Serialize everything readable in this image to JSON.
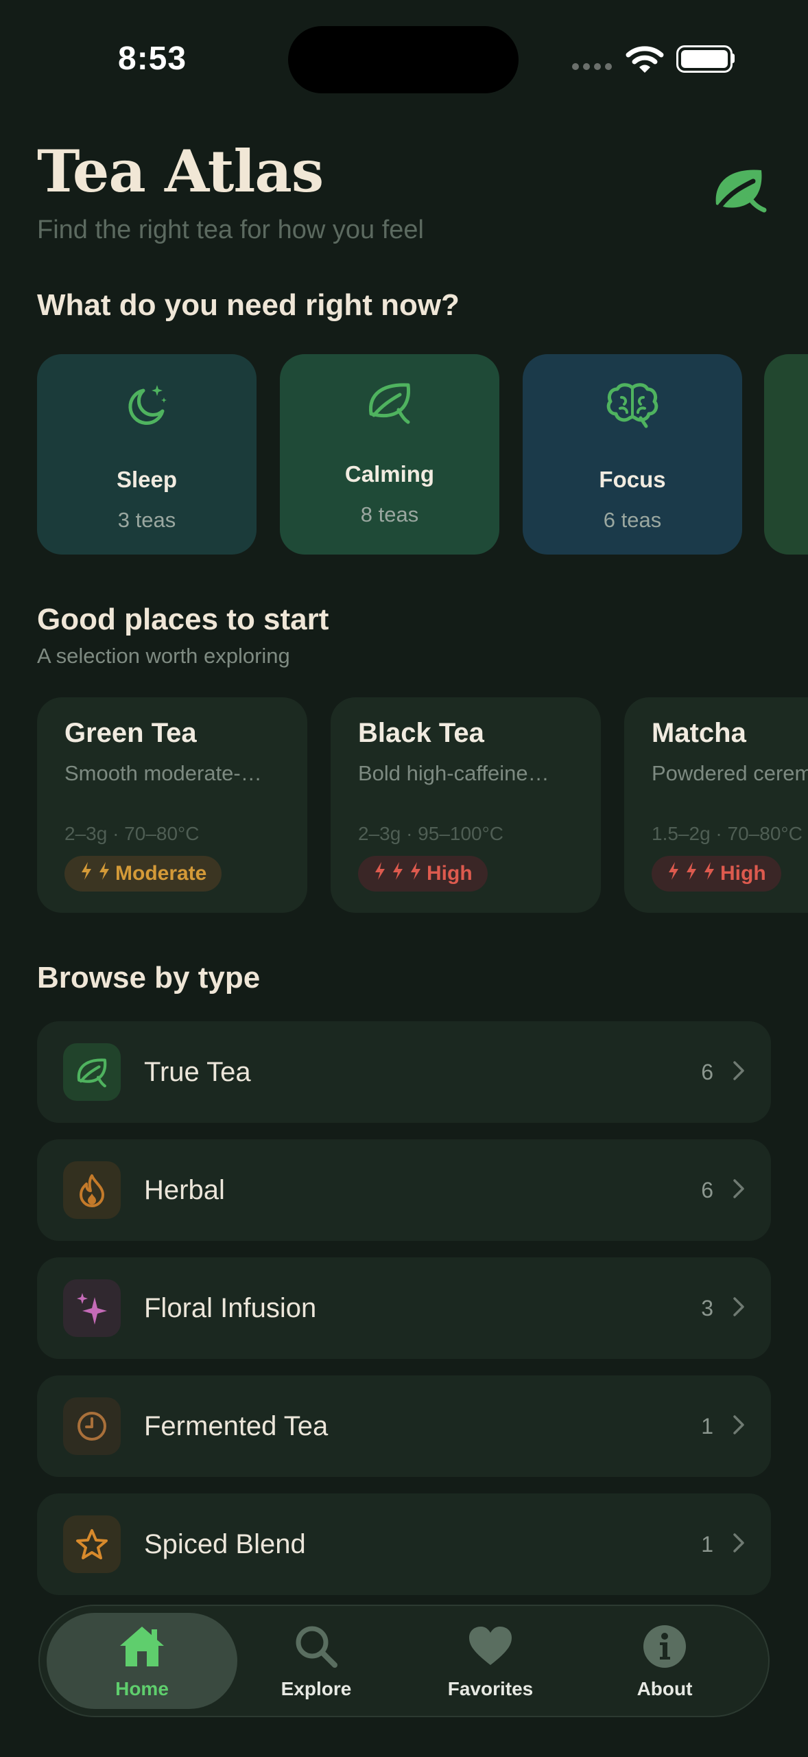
{
  "status": {
    "time": "8:53"
  },
  "header": {
    "title": "Tea Atlas",
    "subtitle": "Find the right tea for how you feel"
  },
  "moods": {
    "title": "What do you need right now?",
    "items": [
      {
        "label": "Sleep",
        "count": "3 teas",
        "icon": "moon-stars-icon"
      },
      {
        "label": "Calming",
        "count": "8 teas",
        "icon": "leaf-icon"
      },
      {
        "label": "Focus",
        "count": "6 teas",
        "icon": "brain-icon"
      }
    ]
  },
  "start": {
    "title": "Good places to start",
    "subtitle": "A selection worth exploring",
    "items": [
      {
        "name": "Green Tea",
        "desc": "Smooth moderate-…",
        "meta": "2–3g · 70–80°C",
        "caffeine": "Moderate",
        "level": 2
      },
      {
        "name": "Black Tea",
        "desc": "Bold high-caffeine…",
        "meta": "2–3g · 95–100°C",
        "caffeine": "High",
        "level": 3
      },
      {
        "name": "Matcha",
        "desc": "Powdered ceremonial",
        "meta": "1.5–2g · 70–80°C",
        "caffeine": "High",
        "level": 3
      }
    ]
  },
  "types": {
    "title": "Browse by type",
    "items": [
      {
        "label": "True Tea",
        "count": "6",
        "icon": "leaf-icon",
        "color": "#4fb35f"
      },
      {
        "label": "Herbal",
        "count": "6",
        "icon": "flame-icon",
        "color": "#c47a2a"
      },
      {
        "label": "Floral Infusion",
        "count": "3",
        "icon": "sparkle-icon",
        "color": "#c56bb8"
      },
      {
        "label": "Fermented Tea",
        "count": "1",
        "icon": "clock-icon",
        "color": "#a9703a"
      },
      {
        "label": "Spiced Blend",
        "count": "1",
        "icon": "star-icon",
        "color": "#d88a2c"
      }
    ]
  },
  "tabs": [
    {
      "label": "Home",
      "icon": "house-icon",
      "active": true
    },
    {
      "label": "Explore",
      "icon": "magnifier-icon",
      "active": false
    },
    {
      "label": "Favorites",
      "icon": "heart-icon",
      "active": false
    },
    {
      "label": "About",
      "icon": "info-icon",
      "active": false
    }
  ],
  "colors": {
    "accent": "#5fce6d",
    "background": "#131c17",
    "moderate": "#d49a38",
    "high": "#dd5a4e"
  }
}
